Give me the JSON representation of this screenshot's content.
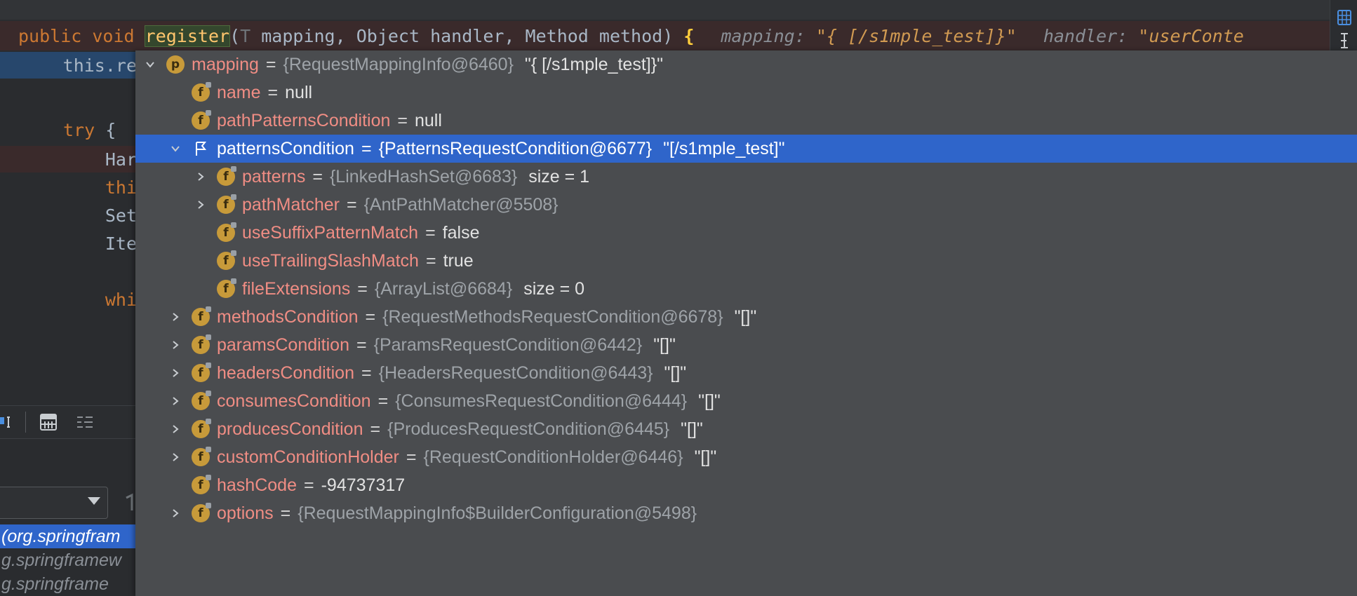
{
  "editor": {
    "signature": {
      "kw_public": "public",
      "kw_void": "void",
      "method_name": "register",
      "open_paren": "(",
      "param_type": "T",
      "params_rest": " mapping, Object handler, Method method) ",
      "brace": "{",
      "hint_mapping_label": "mapping: ",
      "hint_mapping_value": "\"{ [/s1mple_test]}\"",
      "hint_handler_label": "handler: ",
      "hint_handler_value": "\"userConte"
    },
    "code_lines": {
      "line1": "this.re",
      "line3_kw": "try",
      "line3_rest": " {",
      "line4": "Har",
      "line5": "thi",
      "line6": "Set",
      "line7": "Ite",
      "line9": "whi"
    },
    "frames": [
      "(org.springfram",
      "g.springframew",
      "g.springframe"
    ]
  },
  "variables": [
    {
      "indent": 0,
      "expand": "expanded",
      "icon": "p",
      "name": "mapping",
      "type": "{RequestMappingInfo@6460}",
      "value": "\"{ [/s1mple_test]}\""
    },
    {
      "indent": 1,
      "expand": "none",
      "icon": "f",
      "name": "name",
      "type": "",
      "value": "null"
    },
    {
      "indent": 1,
      "expand": "none",
      "icon": "f",
      "name": "pathPatternsCondition",
      "type": "",
      "value": "null"
    },
    {
      "indent": 1,
      "expand": "expanded",
      "icon": "flag",
      "name": "patternsCondition",
      "type": "{PatternsRequestCondition@6677}",
      "value": "\"[/s1mple_test]\"",
      "selected": true
    },
    {
      "indent": 2,
      "expand": "collapsed",
      "icon": "f",
      "name": "patterns",
      "type": "{LinkedHashSet@6683}",
      "value": "size = 1"
    },
    {
      "indent": 2,
      "expand": "collapsed",
      "icon": "f",
      "name": "pathMatcher",
      "type": "{AntPathMatcher@5508}",
      "value": ""
    },
    {
      "indent": 2,
      "expand": "none",
      "icon": "f",
      "name": "useSuffixPatternMatch",
      "type": "",
      "value": "false"
    },
    {
      "indent": 2,
      "expand": "none",
      "icon": "f",
      "name": "useTrailingSlashMatch",
      "type": "",
      "value": "true"
    },
    {
      "indent": 2,
      "expand": "none",
      "icon": "f",
      "name": "fileExtensions",
      "type": "{ArrayList@6684}",
      "value": "size = 0"
    },
    {
      "indent": 1,
      "expand": "collapsed",
      "icon": "f",
      "name": "methodsCondition",
      "type": "{RequestMethodsRequestCondition@6678}",
      "value": "\"[]\""
    },
    {
      "indent": 1,
      "expand": "collapsed",
      "icon": "f",
      "name": "paramsCondition",
      "type": "{ParamsRequestCondition@6442}",
      "value": "\"[]\""
    },
    {
      "indent": 1,
      "expand": "collapsed",
      "icon": "f",
      "name": "headersCondition",
      "type": "{HeadersRequestCondition@6443}",
      "value": "\"[]\""
    },
    {
      "indent": 1,
      "expand": "collapsed",
      "icon": "f",
      "name": "consumesCondition",
      "type": "{ConsumesRequestCondition@6444}",
      "value": "\"[]\""
    },
    {
      "indent": 1,
      "expand": "collapsed",
      "icon": "f",
      "name": "producesCondition",
      "type": "{ProducesRequestCondition@6445}",
      "value": "\"[]\""
    },
    {
      "indent": 1,
      "expand": "collapsed",
      "icon": "f",
      "name": "customConditionHolder",
      "type": "{RequestConditionHolder@6446}",
      "value": "\"[]\""
    },
    {
      "indent": 1,
      "expand": "none",
      "icon": "f",
      "name": "hashCode",
      "type": "",
      "value": "-94737317"
    },
    {
      "indent": 1,
      "expand": "collapsed",
      "icon": "f",
      "name": "options",
      "type": "{RequestMappingInfo$BuilderConfiguration@5498}",
      "value": ""
    }
  ]
}
